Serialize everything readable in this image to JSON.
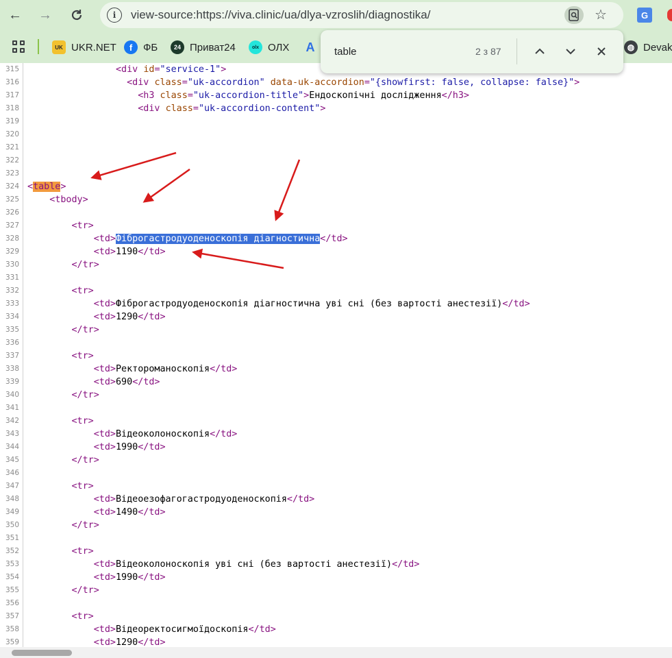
{
  "browser": {
    "url": "view-source:https://viva.clinic/ua/dlya-vzroslih/diagnostika/",
    "bookmarks": [
      {
        "label": "UKR.NET",
        "icon": "ukrnet-icon",
        "color": "#f2c12e"
      },
      {
        "label": "ФБ",
        "icon": "facebook-icon",
        "color": "#1877f2"
      },
      {
        "label": "Приват24",
        "icon": "privat24-icon",
        "color": "#1d3a2b"
      },
      {
        "label": "ОЛХ",
        "icon": "olx-icon",
        "color": "#23e5db"
      },
      {
        "label": "A",
        "icon": "a-app-icon",
        "color": "#2f6fe4"
      },
      {
        "label": "Devaka",
        "icon": "globe-icon",
        "color": "#3c4043"
      }
    ]
  },
  "find": {
    "query": "table",
    "count": "2 з 87"
  },
  "source": {
    "lines": [
      {
        "n": "315",
        "html": "                <span class=\"tag\">&lt;div</span> <span class=\"an\">id</span><span class=\"tag\">=</span><span class=\"av\">\"service-1\"</span><span class=\"tag\">&gt;</span>"
      },
      {
        "n": "316",
        "html": "                  <span class=\"tag\">&lt;div</span> <span class=\"an\">class</span><span class=\"tag\">=</span><span class=\"av\">\"uk-accordion\"</span> <span class=\"an\">data-uk-accordion</span><span class=\"tag\">=</span><span class=\"av\">\"{showfirst: false, collapse: false}\"</span><span class=\"tag\">&gt;</span>"
      },
      {
        "n": "317",
        "html": "                    <span class=\"tag\">&lt;h3</span> <span class=\"an\">class</span><span class=\"tag\">=</span><span class=\"av\">\"uk-accordion-title\"</span><span class=\"tag\">&gt;</span>Ендоскопічні дослідження<span class=\"tag\">&lt;/h3&gt;</span>"
      },
      {
        "n": "318",
        "html": "                    <span class=\"tag\">&lt;div</span> <span class=\"an\">class</span><span class=\"tag\">=</span><span class=\"av\">\"uk-accordion-content\"</span><span class=\"tag\">&gt;</span>"
      },
      {
        "n": "319",
        "html": ""
      },
      {
        "n": "320",
        "html": ""
      },
      {
        "n": "321",
        "html": ""
      },
      {
        "n": "322",
        "html": ""
      },
      {
        "n": "323",
        "html": ""
      },
      {
        "n": "324",
        "html": "<span class=\"tag\">&lt;</span><span class=\"tag hl-orange\">table</span><span class=\"tag\">&gt;</span>"
      },
      {
        "n": "325",
        "html": "    <span class=\"tag\">&lt;tbody&gt;</span>"
      },
      {
        "n": "326",
        "html": ""
      },
      {
        "n": "327",
        "html": "        <span class=\"tag\">&lt;tr&gt;</span>"
      },
      {
        "n": "328",
        "html": "            <span class=\"tag\">&lt;td&gt;</span><span class=\"hl-blue\">Фіброгастродуоденоскопія діагностична</span><span class=\"tag\">&lt;/td&gt;</span>"
      },
      {
        "n": "329",
        "html": "            <span class=\"tag\">&lt;td&gt;</span>1190<span class=\"tag\">&lt;/td&gt;</span>"
      },
      {
        "n": "330",
        "html": "        <span class=\"tag\">&lt;/tr&gt;</span>"
      },
      {
        "n": "331",
        "html": ""
      },
      {
        "n": "332",
        "html": "        <span class=\"tag\">&lt;tr&gt;</span>"
      },
      {
        "n": "333",
        "html": "            <span class=\"tag\">&lt;td&gt;</span>Фіброгастродуоденоскопія діагностична уві сні (без вартості анестезії)<span class=\"tag\">&lt;/td&gt;</span>"
      },
      {
        "n": "334",
        "html": "            <span class=\"tag\">&lt;td&gt;</span>1290<span class=\"tag\">&lt;/td&gt;</span>"
      },
      {
        "n": "335",
        "html": "        <span class=\"tag\">&lt;/tr&gt;</span>"
      },
      {
        "n": "336",
        "html": ""
      },
      {
        "n": "337",
        "html": "        <span class=\"tag\">&lt;tr&gt;</span>"
      },
      {
        "n": "338",
        "html": "            <span class=\"tag\">&lt;td&gt;</span>Ректороманоскопія<span class=\"tag\">&lt;/td&gt;</span>"
      },
      {
        "n": "339",
        "html": "            <span class=\"tag\">&lt;td&gt;</span>690<span class=\"tag\">&lt;/td&gt;</span>"
      },
      {
        "n": "340",
        "html": "        <span class=\"tag\">&lt;/tr&gt;</span>"
      },
      {
        "n": "341",
        "html": ""
      },
      {
        "n": "342",
        "html": "        <span class=\"tag\">&lt;tr&gt;</span>"
      },
      {
        "n": "343",
        "html": "            <span class=\"tag\">&lt;td&gt;</span>Відеоколоноскопія<span class=\"tag\">&lt;/td&gt;</span>"
      },
      {
        "n": "344",
        "html": "            <span class=\"tag\">&lt;td&gt;</span>1990<span class=\"tag\">&lt;/td&gt;</span>"
      },
      {
        "n": "345",
        "html": "        <span class=\"tag\">&lt;/tr&gt;</span>"
      },
      {
        "n": "346",
        "html": ""
      },
      {
        "n": "347",
        "html": "        <span class=\"tag\">&lt;tr&gt;</span>"
      },
      {
        "n": "348",
        "html": "            <span class=\"tag\">&lt;td&gt;</span>Відеоезофагогастродуоденоскопія<span class=\"tag\">&lt;/td&gt;</span>"
      },
      {
        "n": "349",
        "html": "            <span class=\"tag\">&lt;td&gt;</span>1490<span class=\"tag\">&lt;/td&gt;</span>"
      },
      {
        "n": "350",
        "html": "        <span class=\"tag\">&lt;/tr&gt;</span>"
      },
      {
        "n": "351",
        "html": ""
      },
      {
        "n": "352",
        "html": "        <span class=\"tag\">&lt;tr&gt;</span>"
      },
      {
        "n": "353",
        "html": "            <span class=\"tag\">&lt;td&gt;</span>Відеоколоноскопія уві сні (без вартості анестезії)<span class=\"tag\">&lt;/td&gt;</span>"
      },
      {
        "n": "354",
        "html": "            <span class=\"tag\">&lt;td&gt;</span>1990<span class=\"tag\">&lt;/td&gt;</span>"
      },
      {
        "n": "355",
        "html": "        <span class=\"tag\">&lt;/tr&gt;</span>"
      },
      {
        "n": "356",
        "html": ""
      },
      {
        "n": "357",
        "html": "        <span class=\"tag\">&lt;tr&gt;</span>"
      },
      {
        "n": "358",
        "html": "            <span class=\"tag\">&lt;td&gt;</span>Відеоректосигмоїдоскопія<span class=\"tag\">&lt;/td&gt;</span>"
      },
      {
        "n": "359",
        "html": "            <span class=\"tag\">&lt;td&gt;</span>1290<span class=\"tag\">&lt;/td&gt;</span>"
      }
    ]
  },
  "colors": {
    "toolbar": "#d7ecd2",
    "tag": "#881280",
    "attr_name": "#994500",
    "attr_value": "#1a1aa6",
    "find_highlight": "#f29a3e",
    "selection": "#3a6fd8",
    "arrow": "#d81b1b"
  }
}
